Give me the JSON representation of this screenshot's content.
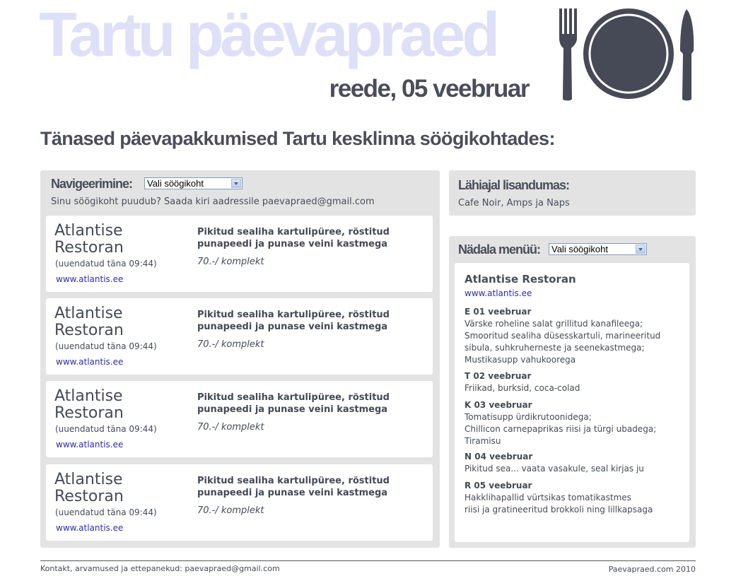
{
  "header": {
    "site_title": "Tartu päevapraed",
    "date": "reede, 05 veebruar"
  },
  "page_heading": "Tänased päevapakkumised Tartu kesklinna söögikohtades:",
  "navigation": {
    "label": "Navigeerimine:",
    "select_value": "Vali söögikoht",
    "missing_note": "Sinu söögikoht puudub? Saada kiri aadressile paevapraed@gmail.com"
  },
  "offers": [
    {
      "name": "Atlantise Restoran",
      "updated": "(uuendatud täna 09:44)",
      "link": "www.atlantis.ee",
      "dish": "Pikitud sealiha kartulipüree, röstitud punapeedi ja punase veini kastmega",
      "price": "70.-/ komplekt"
    },
    {
      "name": "Atlantise Restoran",
      "updated": "(uuendatud täna 09:44)",
      "link": "www.atlantis.ee",
      "dish": "Pikitud sealiha kartulipüree, röstitud punapeedi ja punase veini kastmega",
      "price": "70.-/ komplekt"
    },
    {
      "name": "Atlantise Restoran",
      "updated": "(uuendatud täna 09:44)",
      "link": "www.atlantis.ee",
      "dish": "Pikitud sealiha kartulipüree, röstitud punapeedi ja punase veini kastmega",
      "price": "70.-/ komplekt"
    },
    {
      "name": "Atlantise Restoran",
      "updated": "(uuendatud täna 09:44)",
      "link": "www.atlantis.ee",
      "dish": "Pikitud sealiha kartulipüree, röstitud punapeedi ja punase veini kastmega",
      "price": "70.-/ komplekt"
    }
  ],
  "coming_soon": {
    "label": "Lähiajal lisandumas:",
    "text": "Cafe Noir, Amps ja Naps"
  },
  "weekly_menu": {
    "label": "Nädala menüü:",
    "select_value": "Vali söögikoht",
    "restaurant": "Atlantise Restoran",
    "link": "www.atlantis.ee",
    "days": [
      {
        "day": "E 01 veebruar",
        "lines": [
          "Värske roheline salat grillitud kanafileega;",
          "Smooritud sealiha düsesskartuli, marineeritud",
          "sibula, suhkruherneste ja seenekastmega;",
          "Mustikasupp vahukoorega"
        ]
      },
      {
        "day": "T 02 veebruar",
        "lines": [
          "Friikad, burksid, coca-colad"
        ]
      },
      {
        "day": "K 03 veebruar",
        "lines": [
          "Tomatisupp ürdikrutoonidega;",
          "Chillicon carnepaprikas riisi ja türgi ubadega;",
          "Tiramisu"
        ]
      },
      {
        "day": "N 04 veebruar",
        "lines": [
          "Pikitud sea... vaata vasakule, seal kirjas ju"
        ]
      },
      {
        "day": "R 05 veebruar",
        "lines": [
          "Hakklihapallid vürtsikas tomatikastmes",
          "riisi ja gratineeritud brokkoli ning lillkapsaga"
        ]
      }
    ]
  },
  "footer": {
    "contact": "Kontakt, arvamused ja ettepanekud: paevapraed@gmail.com",
    "copyright": "Paevapraed.com 2010"
  },
  "icons": {
    "logo": "plate-fork-knife-icon",
    "select_arrow": "chevron-down-icon"
  },
  "colors": {
    "title": "#dde0f7",
    "text": "#4a4e5a",
    "panel": "#e3e3e3",
    "link": "#2d2db0"
  }
}
